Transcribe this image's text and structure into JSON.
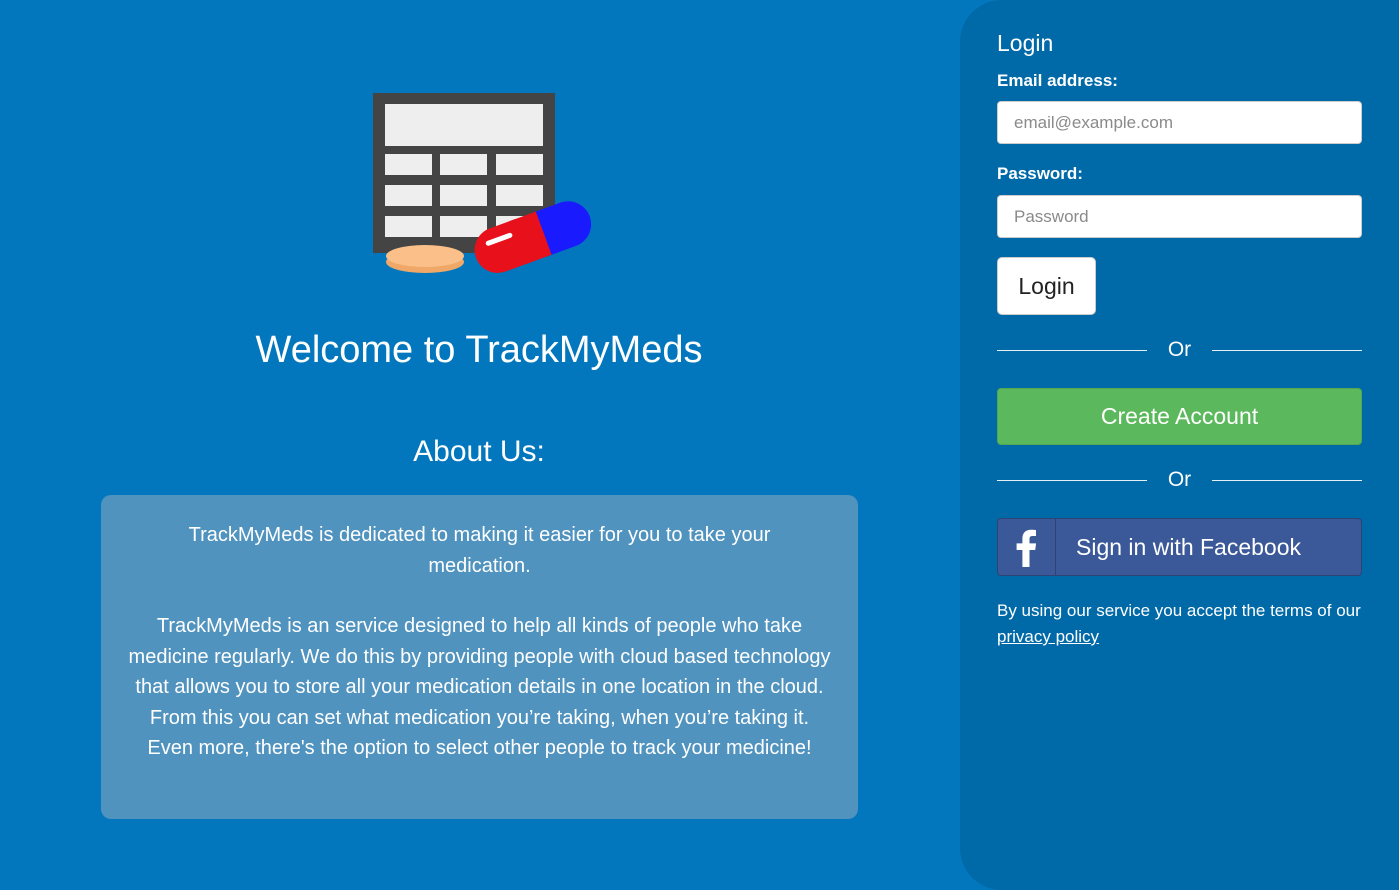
{
  "main": {
    "welcome_title": "Welcome to TrackMyMeds",
    "about_heading": "About Us:",
    "about_paragraph_1": "TrackMyMeds is dedicated to making it easier for you to take your medication.",
    "about_paragraph_2": "TrackMyMeds is an service designed to help all kinds of people who take medicine regularly. We do this by providing people with cloud based technology that allows you to store all your medication details in one location in the cloud. From this you can set what medication you’re taking, when you’re taking it. Even more, there's the option to select other people to track your medicine!"
  },
  "login": {
    "title": "Login",
    "email_label": "Email address:",
    "email_placeholder": "email@example.com",
    "email_value": "",
    "password_label": "Password:",
    "password_placeholder": "Password",
    "password_value": "",
    "login_button": "Login",
    "or_text_1": "Or",
    "create_account_button": "Create Account",
    "or_text_2": "Or",
    "facebook_button": "Sign in with Facebook",
    "facebook_icon": "facebook-icon",
    "terms_text": "By using our service you accept the terms of our",
    "privacy_link": "privacy policy"
  },
  "colors": {
    "background": "#0277bd",
    "panel": "#0069a8",
    "about_box": "#5093bf",
    "create_account": "#5cb85c",
    "facebook": "#3b5998"
  },
  "logo_icon": "calendar-pills-logo"
}
